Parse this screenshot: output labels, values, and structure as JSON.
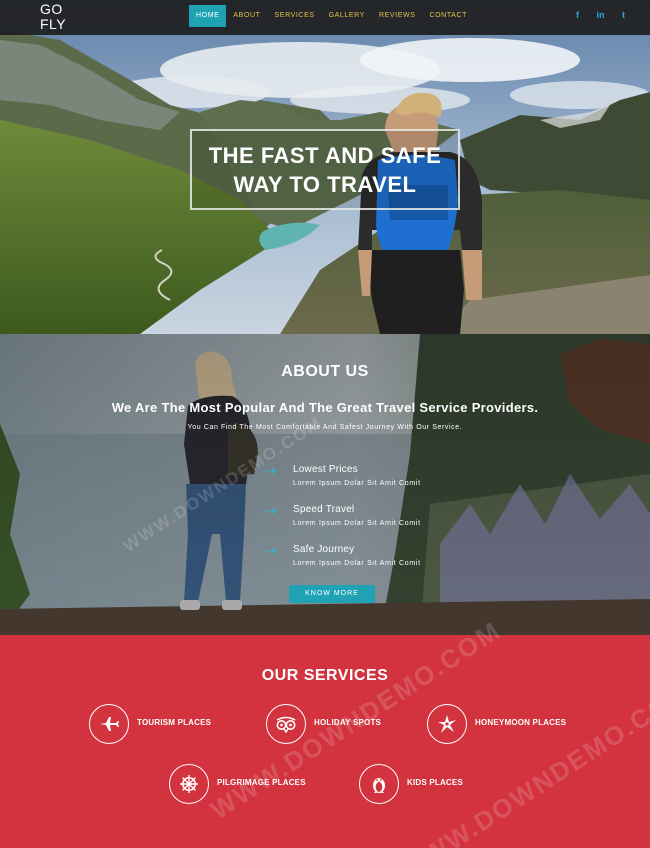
{
  "brand": {
    "logo": "GO FLY"
  },
  "nav": {
    "items": [
      {
        "label": "HOME",
        "active": true
      },
      {
        "label": "ABOUT"
      },
      {
        "label": "SERVICES"
      },
      {
        "label": "GALLERY"
      },
      {
        "label": "REVIEWS"
      },
      {
        "label": "CONTACT"
      }
    ],
    "social": [
      {
        "icon": "facebook-icon",
        "glyph": "f"
      },
      {
        "icon": "linkedin-icon",
        "glyph": "in"
      },
      {
        "icon": "twitter-icon",
        "glyph": "t"
      }
    ]
  },
  "hero": {
    "line1": "THE FAST AND SAFE",
    "line2": "WAY TO TRAVEL"
  },
  "about": {
    "title": "ABOUT US",
    "subtitle": "We Are The Most Popular And The Great Travel Service Providers.",
    "description": "You Can Find The Most Comfortable And Safest Journey With Our Service.",
    "features": [
      {
        "title": "Lowest Prices",
        "text": "Lorem Ipsum Dolar Sit Amit Comit"
      },
      {
        "title": "Speed Travel",
        "text": "Lorem Ipsum Dolar Sit Amit Comit"
      },
      {
        "title": "Safe Journey",
        "text": "Lorem Ipsum Dolar Sit Amit Comit"
      }
    ],
    "button": "KNOW MORE"
  },
  "services": {
    "title": "OUR SERVICES",
    "items": [
      {
        "label": "TOURISM PLACES",
        "icon": "airplane-icon"
      },
      {
        "label": "HOLIDAY SPOTS",
        "icon": "tripadvisor-icon"
      },
      {
        "label": "HONEYMOON PLACES",
        "icon": "shuriken-icon"
      },
      {
        "label": "PILGRIMAGE PLACES",
        "icon": "ship-wheel-icon"
      },
      {
        "label": "KIDS PLACES",
        "icon": "penguin-icon"
      }
    ]
  },
  "watermark": {
    "text": "WWW.DOWNDEMO.COM"
  },
  "colors": {
    "accent": "#1fa3b4",
    "nav_link": "#e8c44a",
    "services_bg": "#d2333e",
    "arrow": "#25c0d8",
    "social": "#2aa7d6"
  }
}
